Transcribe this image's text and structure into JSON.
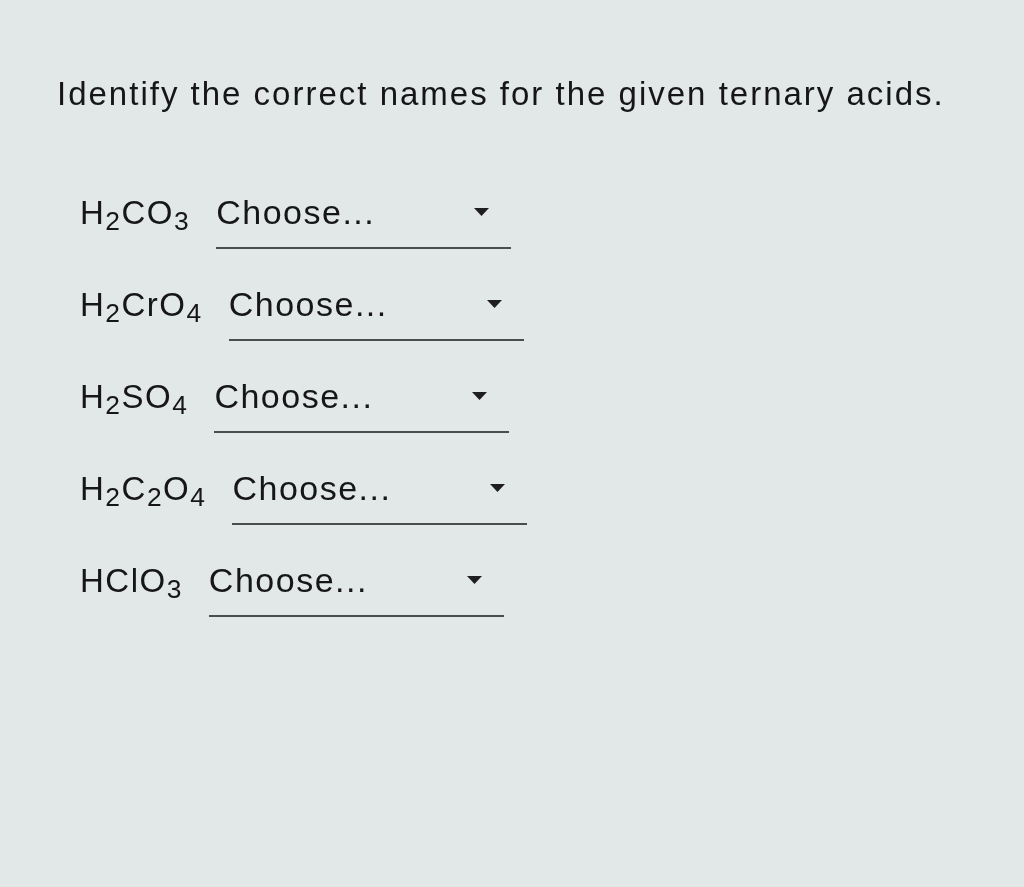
{
  "question": {
    "text": "Identify the correct names for the given ternary acids."
  },
  "items": [
    {
      "formula": "H$_{2}$CO$_{3}$",
      "choice": "Choose..."
    },
    {
      "formula": "H$_{2}$CrO$_{4}$",
      "choice": "Choose..."
    },
    {
      "formula": "H$_{2}$SO$_{4}$",
      "choice": "Choose..."
    },
    {
      "formula": "H$_{2}$C$_{2}$O$_{4}$",
      "choice": "Choose..."
    },
    {
      "formula": "HClO$_{3}$",
      "choice": "Choose..."
    }
  ]
}
